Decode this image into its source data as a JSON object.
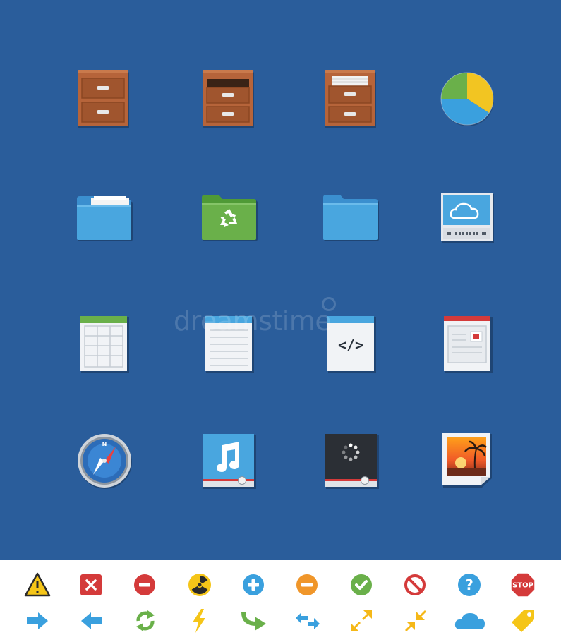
{
  "watermark": {
    "text": "dreamstime"
  },
  "stop_sign": {
    "label": "STOP"
  },
  "code_doc": {
    "label": "</>"
  },
  "compass": {
    "letter": "N"
  },
  "colors": {
    "background": "#2a5d9b",
    "strip": "#ffffff",
    "wood": "#b6643a",
    "folder_blue": "#49a6df",
    "folder_green": "#6ab04a",
    "pie_green": "#6ab04a",
    "pie_yellow": "#f2c522",
    "pie_blue": "#3aa0de"
  },
  "icons_large": [
    "two-drawer-cabinet-icon",
    "open-drawer-cabinet-icon",
    "drawer-with-files-icon",
    "pie-chart-icon",
    "folder-with-papers-icon",
    "recycle-folder-icon",
    "blue-folder-icon",
    "cloud-server-icon",
    "spreadsheet-icon",
    "text-document-icon",
    "code-document-icon",
    "webpage-document-icon",
    "compass-icon",
    "music-player-icon",
    "video-player-icon",
    "image-file-icon"
  ],
  "icons_small_row1": [
    "warning-icon",
    "close-icon",
    "minus-red-icon",
    "radiation-icon",
    "plus-icon",
    "minus-orange-icon",
    "check-icon",
    "prohibited-icon",
    "help-icon",
    "stop-icon"
  ],
  "icons_small_row2": [
    "arrow-right-icon",
    "arrow-left-icon",
    "refresh-icon",
    "lightning-icon",
    "redirect-arrow-icon",
    "swap-arrows-icon",
    "expand-icon",
    "collapse-icon",
    "cloud-icon",
    "tag-icon"
  ]
}
